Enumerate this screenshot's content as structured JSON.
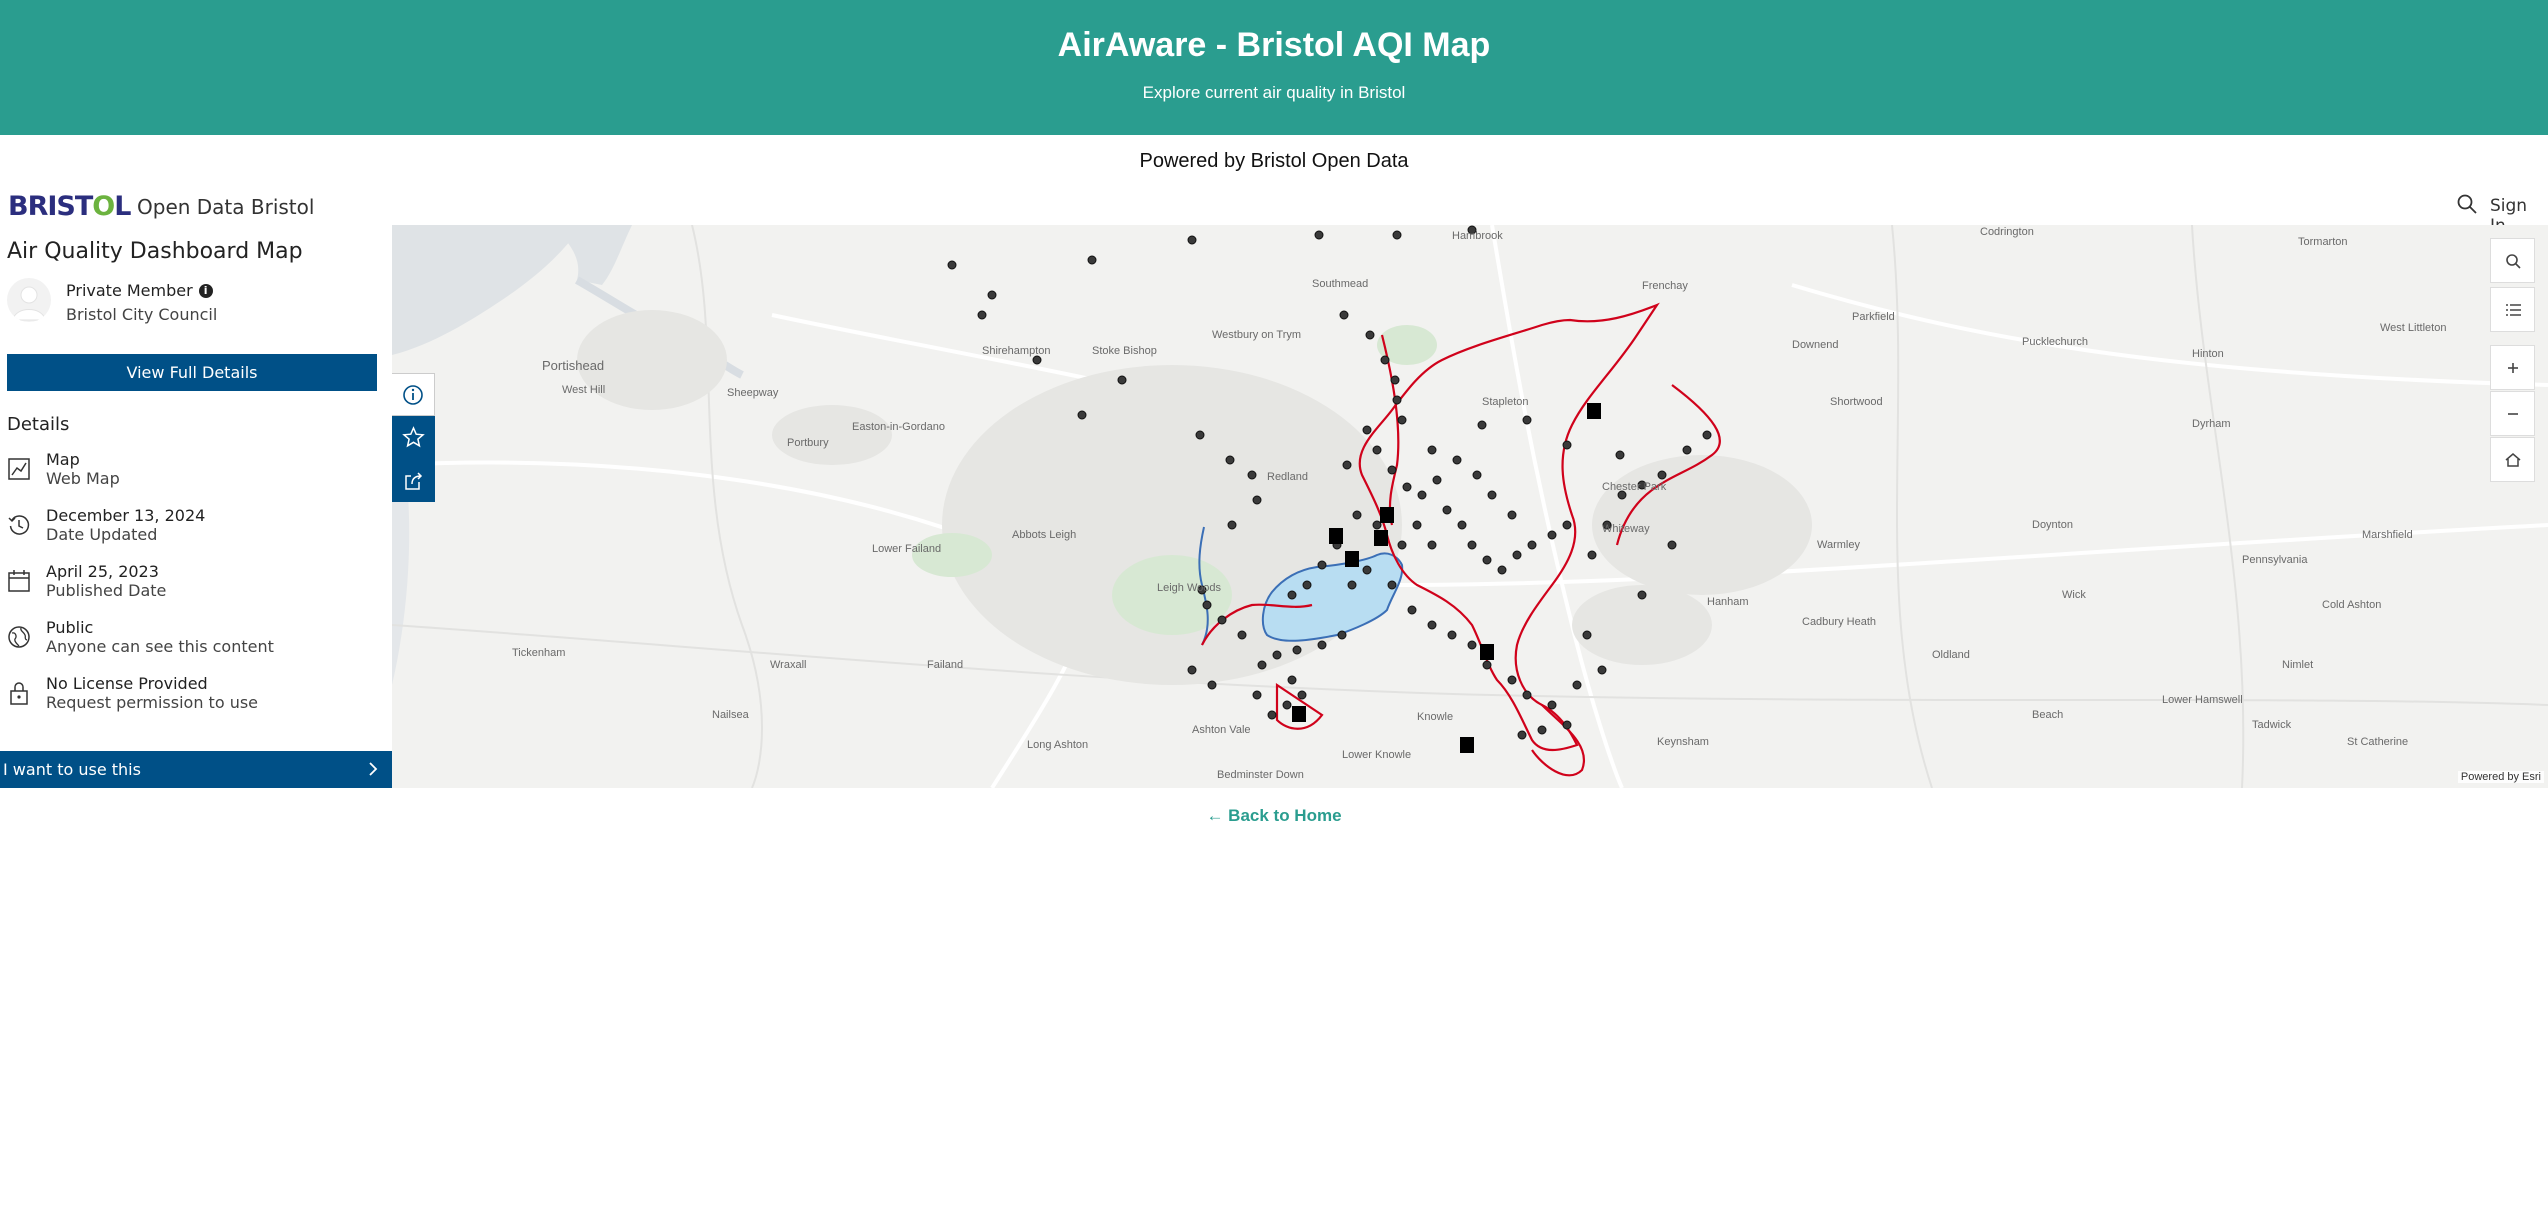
{
  "hero": {
    "title": "AirAware - Bristol AQI Map",
    "subtitle": "Explore current air quality in Bristol",
    "background_color": "#2a9d8f"
  },
  "powered_by": "Powered by Bristol Open Data",
  "portal": {
    "logo_text": "BRISTOL",
    "site_name": "Open Data Bristol",
    "search_icon": "search-icon",
    "sign_in": "Sign In"
  },
  "item": {
    "title": "Air Quality Dashboard Map",
    "owner": {
      "name": "Private Member",
      "organization": "Bristol City Council"
    },
    "view_details_button": "View Full Details",
    "details_heading": "Details",
    "details": [
      {
        "icon": "map-icon",
        "main": "Map",
        "sub": "Web Map"
      },
      {
        "icon": "history-icon",
        "main": "December 13, 2024",
        "sub": "Date Updated"
      },
      {
        "icon": "calendar-icon",
        "main": "April 25, 2023",
        "sub": "Published Date"
      },
      {
        "icon": "globe-icon",
        "main": "Public",
        "sub": "Anyone can see this content"
      },
      {
        "icon": "lock-icon",
        "main": "No License Provided",
        "sub": "Request permission to use"
      }
    ],
    "use_button": "I want to use this",
    "accent_color": "#005087"
  },
  "panel_tabs": [
    {
      "icon": "info-icon",
      "active": true
    },
    {
      "icon": "star-icon",
      "active": false
    },
    {
      "icon": "share-icon",
      "active": false
    }
  ],
  "map": {
    "place_labels": [
      "Hambrook",
      "Frenchay",
      "Codrington",
      "Tormarton",
      "Parkfield",
      "Pucklechurch",
      "Hinton",
      "West Littleton",
      "Portishead",
      "Sheepway",
      "Portbury",
      "Easton-in-Gordano",
      "Shirehampton",
      "Stoke Bishop",
      "Westbury on Trym",
      "Southmead",
      "Stapleton",
      "Downend",
      "Shortwood",
      "Dyrham",
      "West Hill",
      "Redland",
      "Chester Park",
      "Whiteway",
      "Warmley",
      "Doynton",
      "Marshfield",
      "Abbots Leigh",
      "Lower Failand",
      "Leigh Woods",
      "Pennsylvania",
      "Cold Ashton",
      "Tickenham",
      "Nailsea",
      "Wraxall",
      "Failand",
      "Long Ashton",
      "Keynsham",
      "Oldland",
      "Wick",
      "Nimlet",
      "Lower Hamswell",
      "Tadwick",
      "Beach",
      "St Catherine",
      "Knowle",
      "Lower Knowle",
      "Ashton Vale",
      "Bedminster Down",
      "Hanham",
      "Cadbury Heath"
    ],
    "controls": [
      "search-icon",
      "layer-list-icon",
      "zoom-in-icon",
      "zoom-out-icon",
      "home-icon"
    ],
    "credit": "Powered by Esri"
  },
  "back_link": "← Back to Home"
}
